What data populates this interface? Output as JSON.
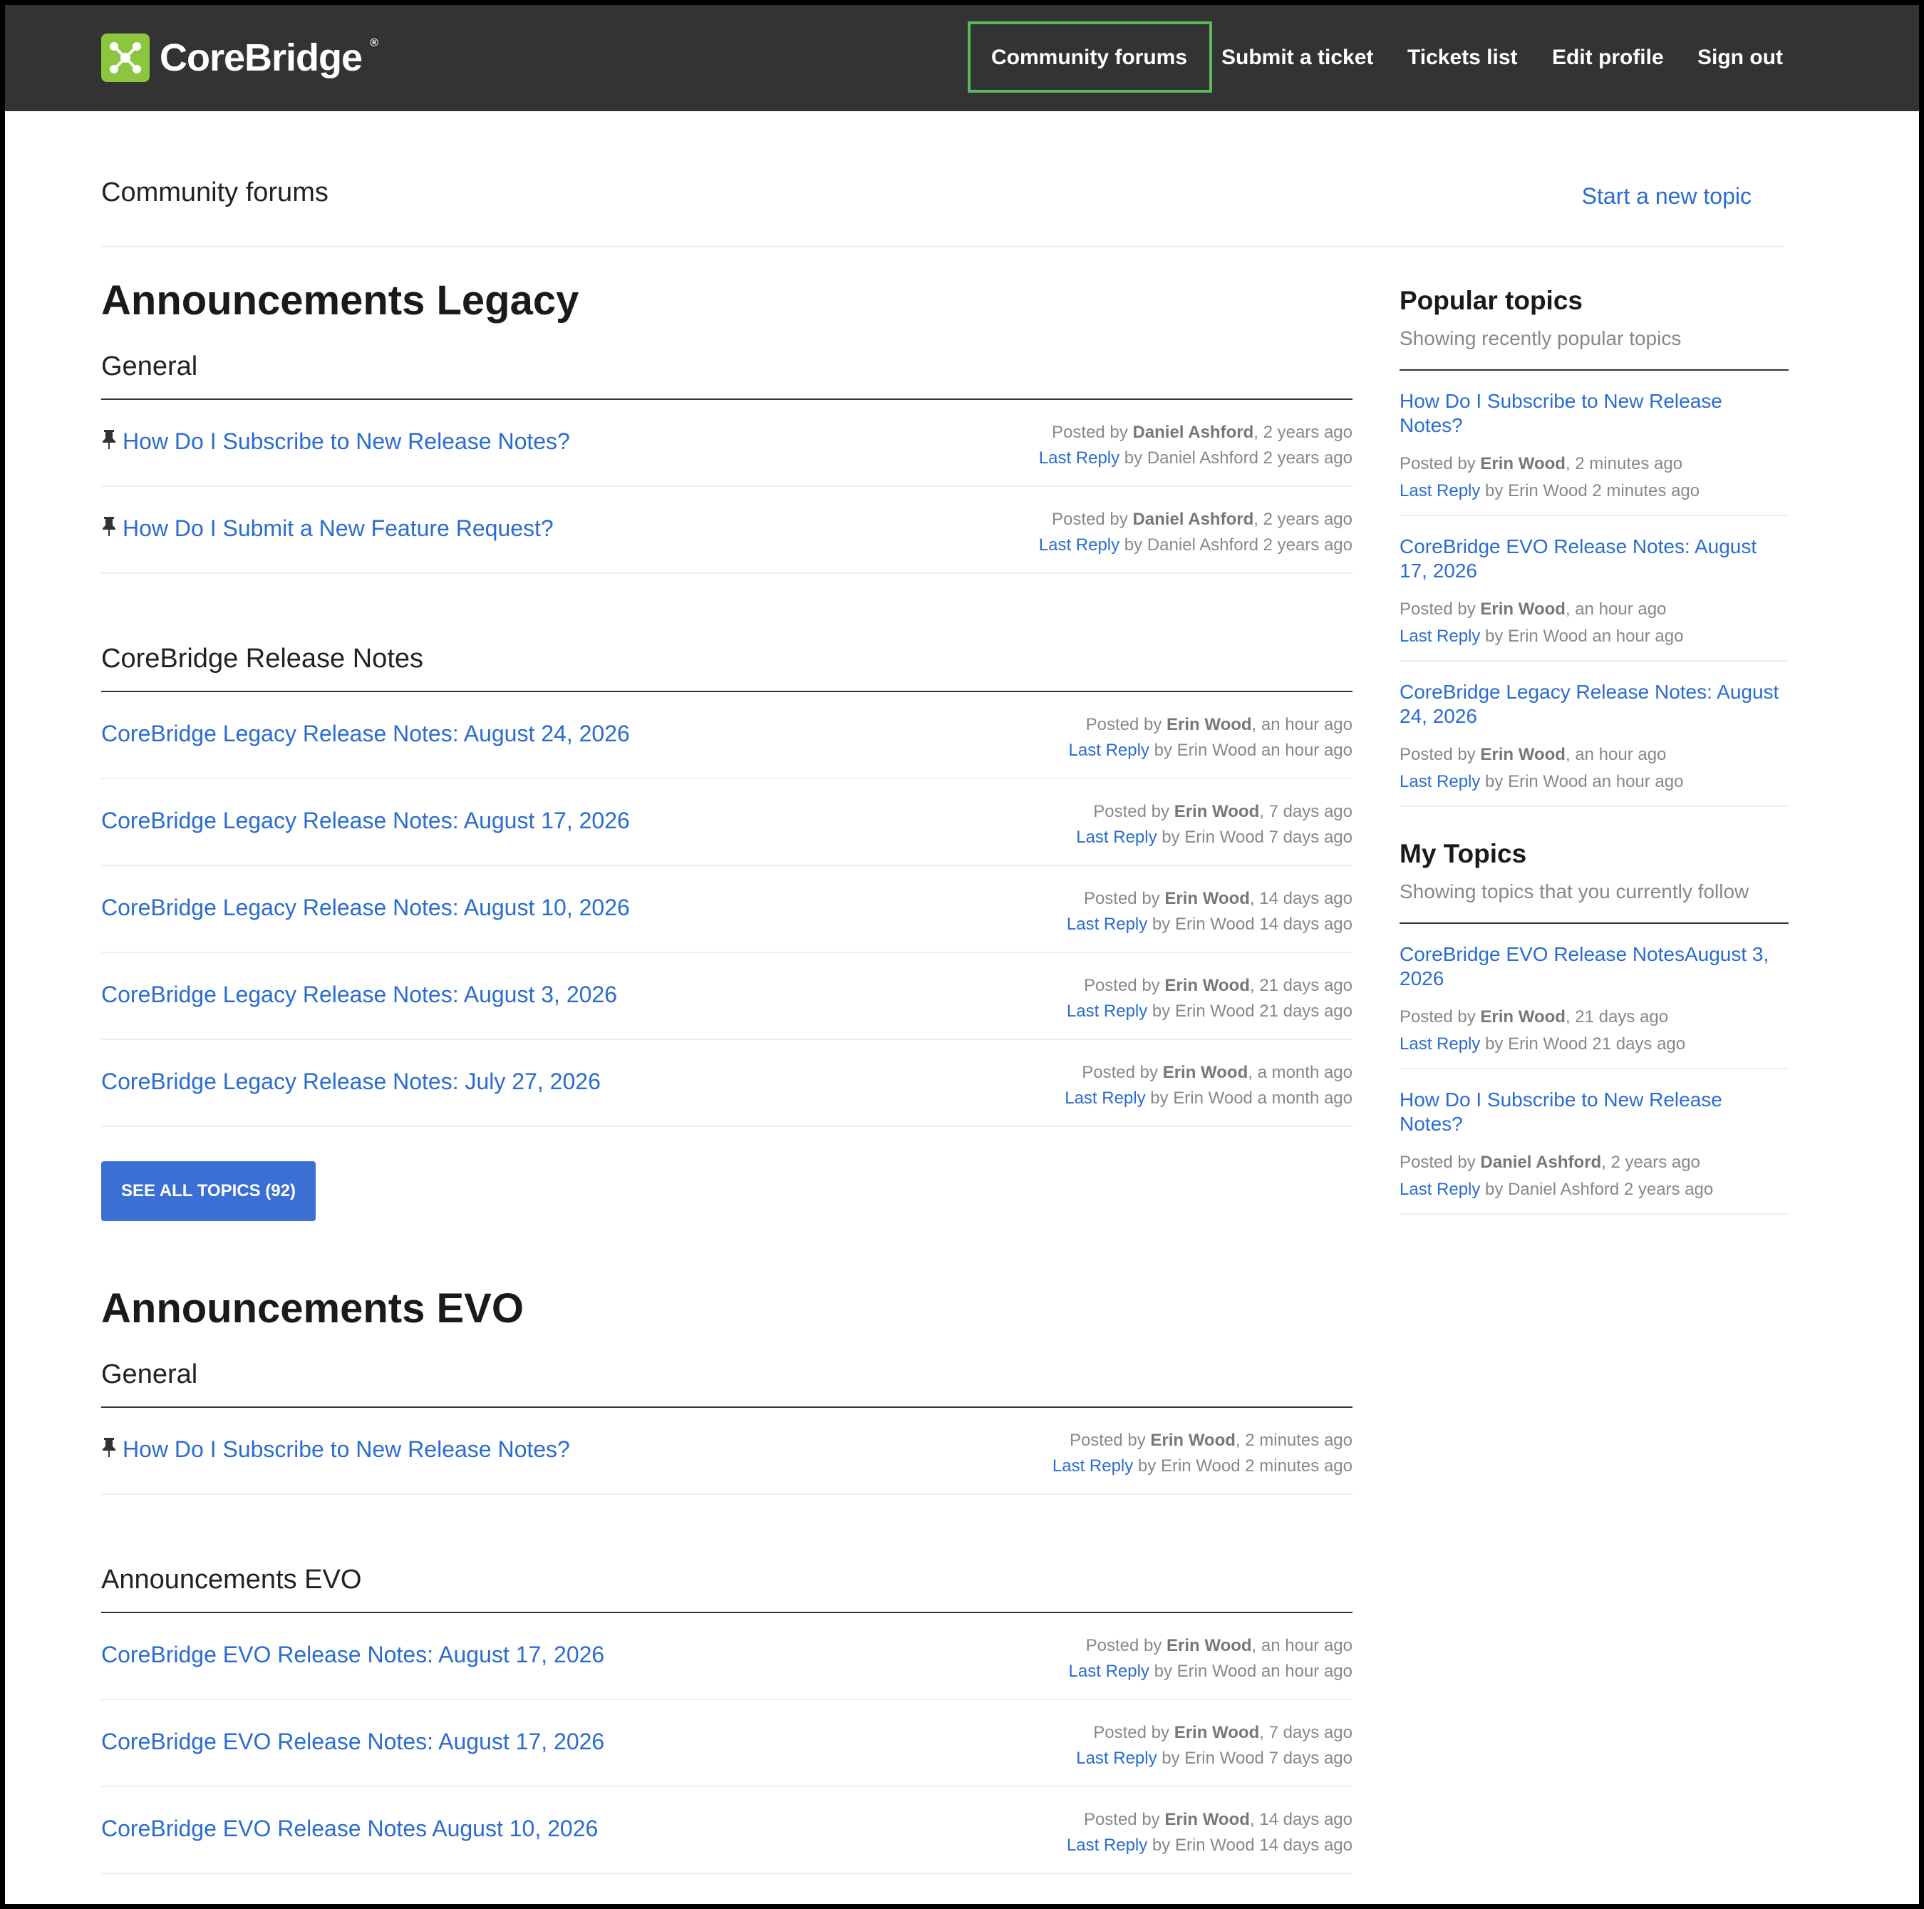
{
  "header": {
    "logo_text": "CoreBridge",
    "logo_reg": "®",
    "nav": [
      {
        "label": "Community forums",
        "active": true
      },
      {
        "label": "Submit a ticket"
      },
      {
        "label": "Tickets list"
      },
      {
        "label": "Edit profile"
      },
      {
        "label": "Sign out"
      }
    ]
  },
  "page": {
    "title": "Community forums",
    "new_topic_label": "Start a new topic"
  },
  "categories": [
    {
      "title": "Announcements Legacy",
      "forums": [
        {
          "title": "General",
          "topics": [
            {
              "pinned": true,
              "title": "How Do I Subscribe to New Release Notes?",
              "posted_prefix": "Posted by ",
              "author": "Daniel Ashford",
              "posted_suffix": ", 2 years ago",
              "last_reply_label": "Last Reply",
              "last_reply_suffix": " by Daniel Ashford 2 years ago"
            },
            {
              "pinned": true,
              "title": "How Do I Submit a New Feature Request?",
              "posted_prefix": "Posted by ",
              "author": "Daniel Ashford",
              "posted_suffix": ", 2 years ago",
              "last_reply_label": "Last Reply",
              "last_reply_suffix": " by Daniel Ashford 2 years ago"
            }
          ]
        },
        {
          "title": "CoreBridge Release Notes",
          "topics": [
            {
              "pinned": false,
              "title": "CoreBridge Legacy Release Notes: August 24, 2026",
              "posted_prefix": "Posted by ",
              "author": "Erin Wood",
              "posted_suffix": ", an hour ago",
              "last_reply_label": "Last Reply",
              "last_reply_suffix": " by Erin Wood an hour ago"
            },
            {
              "pinned": false,
              "title": "CoreBridge Legacy Release Notes: August 17, 2026",
              "posted_prefix": "Posted by ",
              "author": "Erin Wood",
              "posted_suffix": ", 7 days ago",
              "last_reply_label": "Last Reply",
              "last_reply_suffix": " by Erin Wood 7 days ago"
            },
            {
              "pinned": false,
              "title": "CoreBridge Legacy Release Notes: August 10, 2026",
              "posted_prefix": "Posted by ",
              "author": "Erin Wood",
              "posted_suffix": ", 14 days ago",
              "last_reply_label": "Last Reply",
              "last_reply_suffix": " by Erin Wood 14 days ago"
            },
            {
              "pinned": false,
              "title": "CoreBridge Legacy Release Notes: August 3, 2026",
              "posted_prefix": "Posted by ",
              "author": "Erin Wood",
              "posted_suffix": ", 21 days ago",
              "last_reply_label": "Last Reply",
              "last_reply_suffix": " by Erin Wood 21 days ago"
            },
            {
              "pinned": false,
              "title": "CoreBridge Legacy Release Notes: July 27, 2026",
              "posted_prefix": "Posted by ",
              "author": "Erin Wood",
              "posted_suffix": ", a month ago",
              "last_reply_label": "Last Reply",
              "last_reply_suffix": " by Erin Wood a month ago"
            }
          ],
          "see_all_label": "SEE ALL TOPICS (92)"
        }
      ]
    },
    {
      "title": "Announcements EVO",
      "forums": [
        {
          "title": "General",
          "topics": [
            {
              "pinned": true,
              "title": "How Do I Subscribe to New Release Notes?",
              "posted_prefix": "Posted by ",
              "author": "Erin Wood",
              "posted_suffix": ", 2 minutes ago",
              "last_reply_label": "Last Reply",
              "last_reply_suffix": " by Erin Wood 2 minutes ago"
            }
          ]
        },
        {
          "title": "Announcements EVO",
          "topics": [
            {
              "pinned": false,
              "title": "CoreBridge EVO Release Notes: August 17, 2026",
              "posted_prefix": "Posted by ",
              "author": "Erin Wood",
              "posted_suffix": ", an hour ago",
              "last_reply_label": "Last Reply",
              "last_reply_suffix": " by Erin Wood an hour ago"
            },
            {
              "pinned": false,
              "title": "CoreBridge EVO Release Notes: August 17, 2026",
              "posted_prefix": "Posted by ",
              "author": "Erin Wood",
              "posted_suffix": ", 7 days ago",
              "last_reply_label": "Last Reply",
              "last_reply_suffix": " by Erin Wood 7 days ago"
            },
            {
              "pinned": false,
              "title": "CoreBridge EVO Release Notes August 10, 2026",
              "posted_prefix": "Posted by ",
              "author": "Erin Wood",
              "posted_suffix": ", 14 days ago",
              "last_reply_label": "Last Reply",
              "last_reply_suffix": " by Erin Wood 14 days ago"
            }
          ]
        }
      ]
    }
  ],
  "sidebar": {
    "sections": [
      {
        "title": "Popular topics",
        "subtitle": "Showing recently popular topics",
        "items": [
          {
            "title": "How Do I Subscribe to New Release Notes?",
            "posted_prefix": "Posted by ",
            "author": "Erin Wood",
            "posted_suffix": ", 2 minutes ago",
            "last_reply_label": "Last Reply",
            "last_reply_suffix": " by Erin Wood 2 minutes ago"
          },
          {
            "title": "CoreBridge EVO Release Notes: August 17, 2026",
            "posted_prefix": "Posted by ",
            "author": "Erin Wood",
            "posted_suffix": ", an hour ago",
            "last_reply_label": "Last Reply",
            "last_reply_suffix": " by Erin Wood an hour ago"
          },
          {
            "title": "CoreBridge Legacy Release Notes: August 24, 2026",
            "posted_prefix": "Posted by ",
            "author": "Erin Wood",
            "posted_suffix": ", an hour ago",
            "last_reply_label": "Last Reply",
            "last_reply_suffix": " by Erin Wood an hour ago"
          }
        ]
      },
      {
        "title": "My Topics",
        "subtitle": "Showing topics that you currently follow",
        "items": [
          {
            "title": "CoreBridge EVO Release NotesAugust 3, 2026",
            "posted_prefix": "Posted by ",
            "author": "Erin Wood",
            "posted_suffix": ", 21 days ago",
            "last_reply_label": "Last Reply",
            "last_reply_suffix": " by Erin Wood 21 days ago"
          },
          {
            "title": "How Do I Subscribe to New Release Notes?",
            "posted_prefix": "Posted by ",
            "author": "Daniel Ashford",
            "posted_suffix": ", 2 years ago",
            "last_reply_label": "Last Reply",
            "last_reply_suffix": " by Daniel Ashford 2 years ago"
          }
        ]
      }
    ]
  },
  "icons": {
    "pin": "pushpin-icon",
    "logo": "corebridge-logo-icon"
  },
  "colors": {
    "header_bg": "#333333",
    "link": "#2a6ccf",
    "button": "#3b6fd4",
    "active_outline": "#5cb85c",
    "logo_green": "#8cc63f"
  }
}
